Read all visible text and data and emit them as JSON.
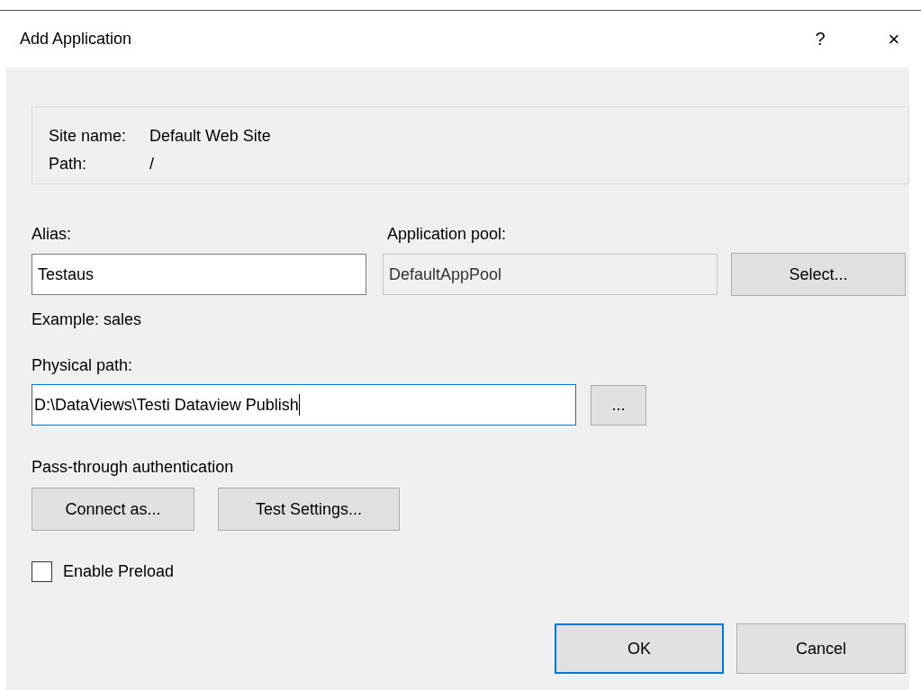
{
  "window": {
    "title": "Add Application",
    "help": "?",
    "close": "×"
  },
  "site_info": [
    {
      "label": "Site name:",
      "value": "Default Web Site"
    },
    {
      "label": "Path:",
      "value": "/"
    }
  ],
  "alias": {
    "label": "Alias:",
    "value": "Testaus",
    "hint": "Example: sales"
  },
  "application_pool": {
    "label": "Application pool:",
    "value": "DefaultAppPool",
    "disabled": true,
    "button": "Select..."
  },
  "physical_path": {
    "label": "Physical path:",
    "value": "D:\\DataViews\\Testi Dataview Publish",
    "focused": true,
    "browse_button": "..."
  },
  "authentication": {
    "label": "Pass-through authentication",
    "buttons": [
      "Connect as...",
      "Test Settings..."
    ]
  },
  "enable_preload": {
    "label": "Enable Preload",
    "checked": false
  },
  "buttons": [
    {
      "label": "OK",
      "default": true
    },
    {
      "label": "Cancel",
      "default": false
    }
  ]
}
